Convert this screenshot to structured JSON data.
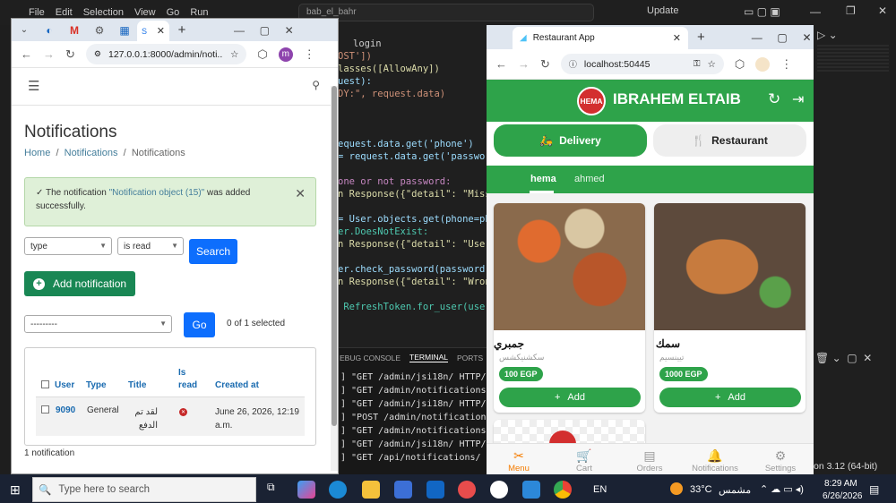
{
  "vscode": {
    "menu": [
      "File",
      "Edit",
      "Selection",
      "View",
      "Go",
      "Run"
    ],
    "search_text": "bab_el_bahr",
    "update_label": "Update",
    "login_tab": "login",
    "code_lines": [
      {
        "text": "OST'])",
        "cls": "str"
      },
      {
        "text": "lasses([AllowAny])",
        "cls": "fn"
      },
      {
        "text": "uest):",
        "cls": "var"
      },
      {
        "text": "DY:\", request.data)",
        "cls": "str"
      },
      {
        "text": "",
        "cls": "var"
      },
      {
        "text": "",
        "cls": "var"
      },
      {
        "text": "",
        "cls": "var"
      },
      {
        "text": "equest.data.get('phone')",
        "cls": "var"
      },
      {
        "text": "= request.data.get('password'",
        "cls": "var"
      },
      {
        "text": "",
        "cls": "var"
      },
      {
        "text": "one or not password:",
        "cls": "kw"
      },
      {
        "text": "n Response({\"detail\": \"Missin",
        "cls": "fn"
      },
      {
        "text": "",
        "cls": "var"
      },
      {
        "text": "= User.objects.get(phone=phon",
        "cls": "var"
      },
      {
        "text": "er.DoesNotExist:",
        "cls": "cls"
      },
      {
        "text": "n Response({\"detail\": \"User n",
        "cls": "fn"
      },
      {
        "text": "",
        "cls": "var"
      },
      {
        "text": "er.check_password(password):",
        "cls": "var"
      },
      {
        "text": "n Response({\"detail\": \"Wrong",
        "cls": "fn"
      },
      {
        "text": "",
        "cls": "var"
      },
      {
        "text": " RefreshToken.for_user(user)",
        "cls": "cls"
      }
    ],
    "panel_tabs": [
      "EBUG CONSOLE",
      "TERMINAL",
      "PORTS"
    ],
    "terminal_lines": [
      "] \"GET /admin/jsi18n/ HTTP/1.1\"",
      "] \"GET /admin/notifications/noti",
      "] \"GET /admin/jsi18n/ HTTP/1.1\"",
      "] \"POST /admin/notifications/not",
      "] \"GET /admin/notifications/noti",
      "] \"GET /admin/jsi18n/ HTTP/1.1\"",
      "] \"GET /api/notifications/ HTTP/"
    ],
    "python_version": "on 3.12 (64-bit)"
  },
  "left_browser": {
    "url": "127.0.0.1:8000/admin/noti...",
    "page_title": "Notifications",
    "breadcrumb": {
      "home": "Home",
      "section": "Notifications",
      "current": "Notifications"
    },
    "success": {
      "prefix": "The notification ",
      "link": "\"Notification object (15)\"",
      "suffix": " was added successfully."
    },
    "filter_type": "type",
    "filter_read": "is read",
    "search_button": "Search",
    "add_button": "Add notification",
    "action_select": "---------",
    "go_button": "Go",
    "selected_count": "0 of 1 selected",
    "columns": [
      "User",
      "Type",
      "Title",
      "Is read",
      "Created at"
    ],
    "row": {
      "user": "9090",
      "type": "General",
      "title": "لقد تم الدفع",
      "created": "June 26, 2026, 12:19 a.m."
    },
    "footer_count": "1 notification"
  },
  "right_browser": {
    "tab_title": "Restaurant App",
    "url": "localhost:50445",
    "badge": "HEMA",
    "app_name": "IBRAHEM ELTAIB",
    "delivery_label": "Delivery",
    "restaurant_label": "Restaurant",
    "tabs": [
      "hema",
      "ahmed"
    ],
    "items": [
      {
        "name": "جمبري",
        "desc": "سكشنيكشس",
        "price": "100 EGP",
        "add": "Add"
      },
      {
        "name": "سمك",
        "desc": "تيينسيم",
        "price": "1000 EGP",
        "add": "Add"
      }
    ],
    "nav": [
      "Menu",
      "Cart",
      "Orders",
      "Notifications",
      "Settings"
    ]
  },
  "taskbar": {
    "search_placeholder": "Type here to search",
    "lang": "EN",
    "weather": "33°C",
    "weather_desc": "مشمس",
    "time": "8:29 AM",
    "date": "6/26/2026"
  }
}
